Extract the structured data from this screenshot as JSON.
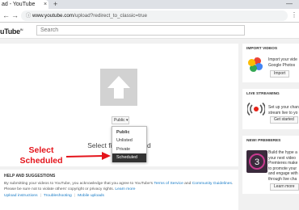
{
  "browser": {
    "tab_title": "ad - YouTube",
    "tab_close": "×",
    "new_tab": "+",
    "window_min": "—",
    "back": "←",
    "forward": "→",
    "url_host": "www.youtube.com",
    "url_path": "/upload?redirect_to_classic=true",
    "lock_icon": "ⓘ",
    "menu": "⋮"
  },
  "youtube": {
    "logo": "uTube",
    "logo_sup": "IN",
    "search_placeholder": "Search"
  },
  "upload": {
    "select_text": "Select files to upload",
    "privacy_button": "Public ▾",
    "privacy_options": [
      "Public",
      "Unlisted",
      "Private",
      "Scheduled"
    ],
    "selected_option": "Scheduled"
  },
  "annotation": {
    "line1": "Select",
    "line2": "Scheduled",
    "color": "#e4141b"
  },
  "help": {
    "title": "HELP AND SUGGESTIONS",
    "text_pre": "By submitting your videos to YouTube, you acknowledge that you agree to YouTube's ",
    "tos_link": "Terms of Service",
    "text_and": " and ",
    "guidelines_link": "Community Guidelines",
    "text_post": ".",
    "line2_pre": "Please be sure not to violate others' copyright or privacy rights. ",
    "learn_more": "Learn more",
    "links": [
      "Upload instructions",
      "Troubleshooting",
      "Mobile uploads"
    ]
  },
  "rail": {
    "import": {
      "title": "IMPORT VIDEOS",
      "desc": [
        "Import your vide",
        "Google Photos"
      ],
      "button": "Import"
    },
    "live": {
      "title": "LIVE STREAMING",
      "desc": [
        "Set up your chan",
        "stream live to yo"
      ],
      "button": "Get started"
    },
    "premieres": {
      "title": "NEW! PREMIERES",
      "desc": [
        "Build the hype a",
        "your next video",
        "Premieres make",
        "to promote your",
        "and engage with",
        "through live cha"
      ],
      "button": "Learn more"
    }
  }
}
